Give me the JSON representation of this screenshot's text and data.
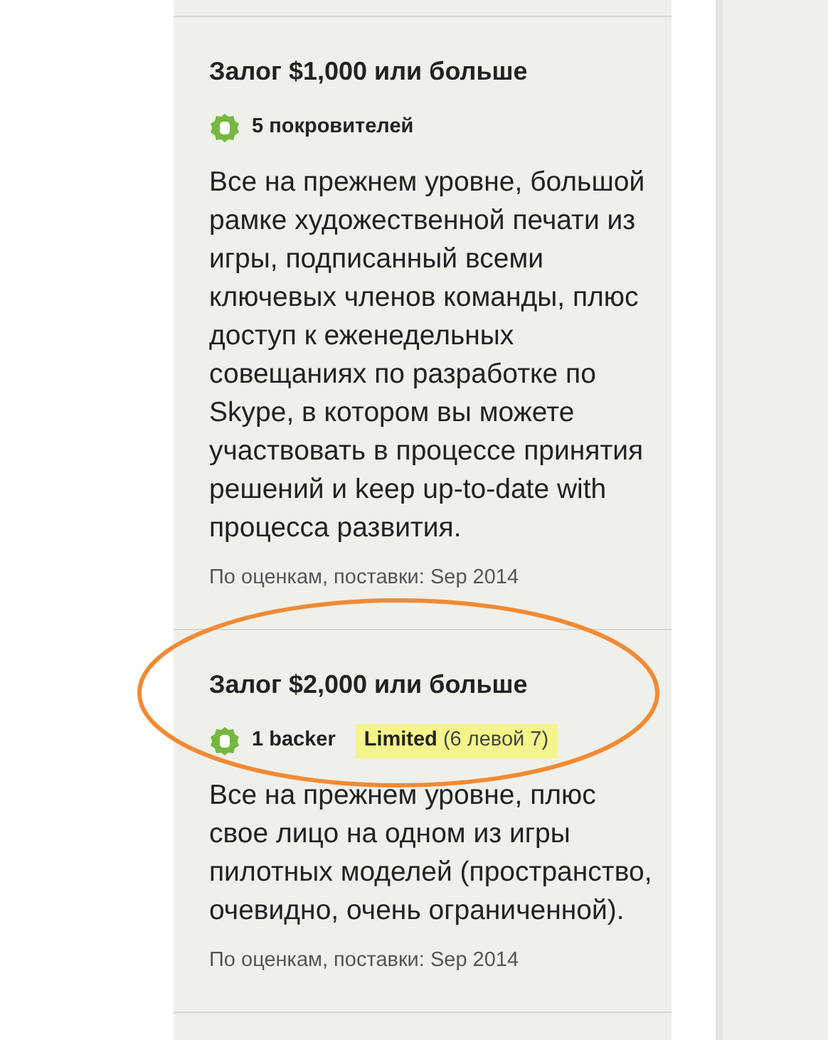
{
  "rewards": [
    {
      "title": "Залог $1,000 или больше",
      "backers": "5 покровителей",
      "description": "Все на прежнем уровне, большой рамке художественной печати из игры, подписанный всеми ключевых членов команды, плюс доступ к еженедельных совещаниях по разработке по Skype, в котором вы можете участвовать в процессе принятия решений и keep up-to-date with процесса развития.",
      "delivery": "По оценкам, поставки: Sep 2014"
    },
    {
      "title": "Залог $2,000 или больше",
      "backers": "1 backer",
      "limited": {
        "label": "Limited",
        "remaining": "(6 левой 7)"
      },
      "description": "Все на прежнем уровне, плюс свое лицо на одном из игры пилотных моделей (пространство, очевидно, очень ограниченной).",
      "delivery": "По оценкам, поставки: Sep 2014"
    }
  ]
}
